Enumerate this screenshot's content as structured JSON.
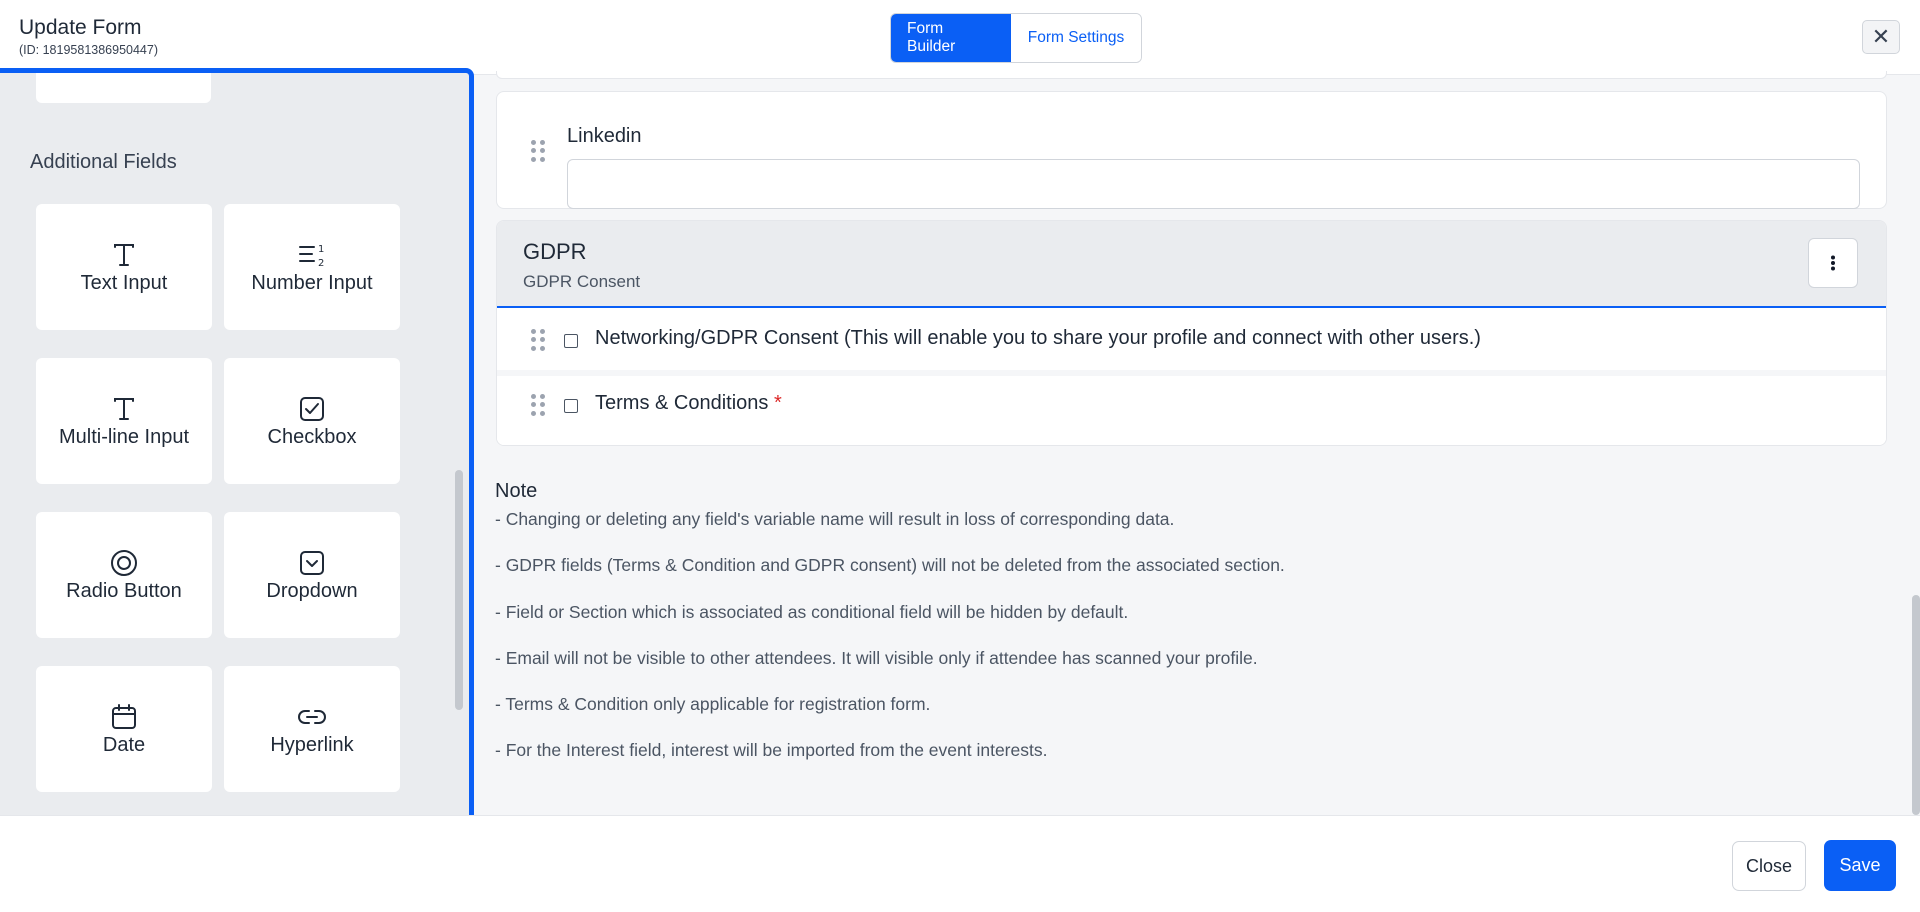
{
  "header": {
    "title": "Update Form",
    "form_id": "(ID: 1819581386950447)",
    "tabs": [
      {
        "label": "Form Builder",
        "active": true
      },
      {
        "label": "Form Settings",
        "active": false
      }
    ],
    "close_icon": "close-icon"
  },
  "palette": {
    "section_title": "Additional Fields",
    "tiles": [
      {
        "label": "Text Input",
        "icon": "text-icon"
      },
      {
        "label": "Number Input",
        "icon": "numbered-list-icon"
      },
      {
        "label": "Multi-line Input",
        "icon": "text-icon"
      },
      {
        "label": "Checkbox",
        "icon": "checkbox-icon"
      },
      {
        "label": "Radio Button",
        "icon": "radio-icon"
      },
      {
        "label": "Dropdown",
        "icon": "dropdown-icon"
      },
      {
        "label": "Date",
        "icon": "calendar-icon"
      },
      {
        "label": "Hyperlink",
        "icon": "link-icon"
      }
    ]
  },
  "form": {
    "linkedin_field": {
      "label": "Linkedin",
      "value": ""
    },
    "gdpr_section": {
      "title": "GDPR",
      "subtitle": "GDPR Consent",
      "items": [
        {
          "label": "Networking/GDPR Consent (This will enable you to share your profile and connect with other users.)",
          "required": false
        },
        {
          "label": "Terms & Conditions",
          "required": true,
          "required_mark": "*"
        }
      ]
    }
  },
  "note": {
    "title": "Note",
    "lines": [
      "- Changing or deleting any field's variable name will result in loss of corresponding data.",
      "- GDPR fields (Terms & Condition and GDPR consent) will not be deleted from the associated section.",
      "- Field or Section which is associated as conditional field will be hidden by default.",
      "- Email will not be visible to other attendees. It will visible only if attendee has scanned your profile.",
      "- Terms & Condition only applicable for registration form.",
      "- For the Interest field, interest will be imported from the event interests."
    ]
  },
  "footer": {
    "close_label": "Close",
    "save_label": "Save"
  },
  "colors": {
    "accent": "#0a5ff5",
    "required": "#dc2626",
    "panel_bg": "#eaecef"
  }
}
